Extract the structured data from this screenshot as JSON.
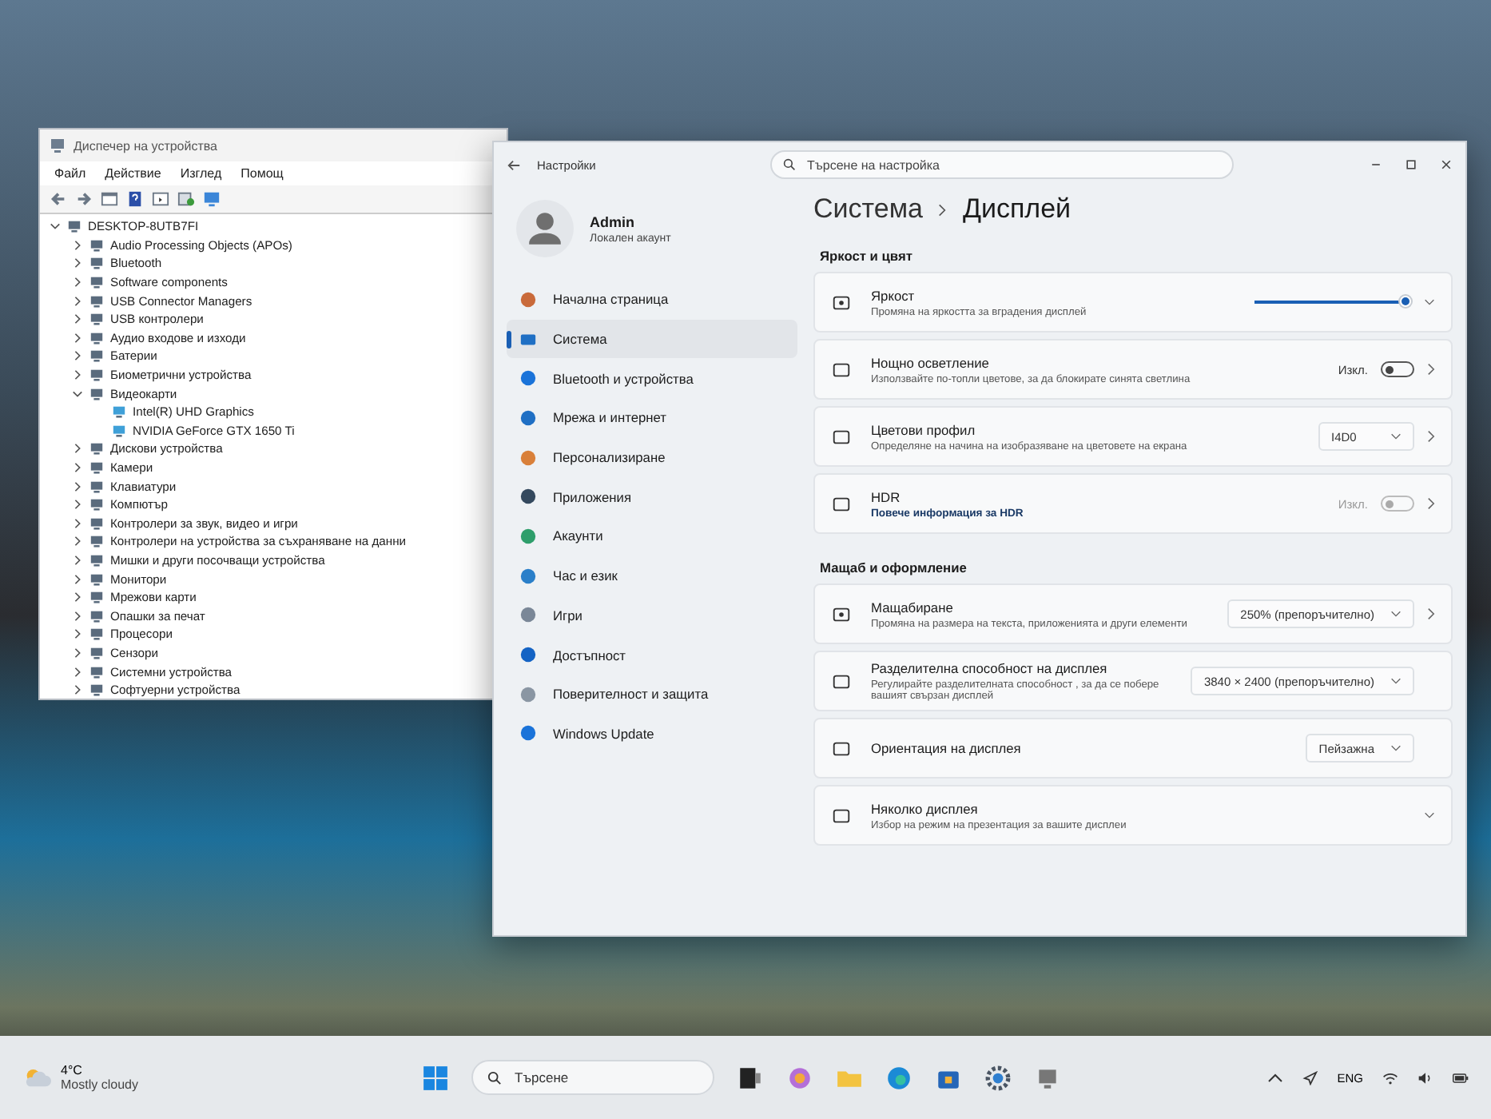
{
  "device_manager": {
    "title": "Диспечер на устройства",
    "menu": [
      "Файл",
      "Действие",
      "Изглед",
      "Помощ"
    ],
    "tree": [
      {
        "label": "DESKTOP-8UTB7FI",
        "expanded": true,
        "children": [
          {
            "label": "Audio Processing Objects (APOs)",
            "expanded": false
          },
          {
            "label": "Bluetooth",
            "expanded": false
          },
          {
            "label": "Software components",
            "expanded": false
          },
          {
            "label": "USB Connector Managers",
            "expanded": false
          },
          {
            "label": "USB контролери",
            "expanded": false
          },
          {
            "label": "Аудио входове и изходи",
            "expanded": false
          },
          {
            "label": "Батерии",
            "expanded": false
          },
          {
            "label": "Биометрични устройства",
            "expanded": false
          },
          {
            "label": "Видеокарти",
            "expanded": true,
            "children": [
              {
                "label": "Intel(R) UHD Graphics"
              },
              {
                "label": "NVIDIA GeForce GTX 1650 Ti"
              }
            ]
          },
          {
            "label": "Дискови устройства",
            "expanded": false
          },
          {
            "label": "Камери",
            "expanded": false
          },
          {
            "label": "Клавиатури",
            "expanded": false
          },
          {
            "label": "Компютър",
            "expanded": false
          },
          {
            "label": "Контролери за звук, видео и игри",
            "expanded": false
          },
          {
            "label": "Контролери на устройства за съхраняване на данни",
            "expanded": false
          },
          {
            "label": "Мишки и други посочващи устройства",
            "expanded": false
          },
          {
            "label": "Монитори",
            "expanded": false
          },
          {
            "label": "Мрежови карти",
            "expanded": false
          },
          {
            "label": "Опашки за печат",
            "expanded": false
          },
          {
            "label": "Процесори",
            "expanded": false
          },
          {
            "label": "Сензори",
            "expanded": false
          },
          {
            "label": "Системни устройства",
            "expanded": false
          },
          {
            "label": "Софтуерни устройства",
            "expanded": false
          }
        ]
      }
    ]
  },
  "settings": {
    "title": "Настройки",
    "search": {
      "placeholder": "Търсене на настройка"
    },
    "user": {
      "name": "Admin",
      "account": "Локален акаунт"
    },
    "nav": [
      {
        "label": "Начална страница",
        "selected": false
      },
      {
        "label": "Система",
        "selected": true
      },
      {
        "label": "Bluetooth и устройства",
        "selected": false
      },
      {
        "label": "Мрежа и интернет",
        "selected": false
      },
      {
        "label": "Персонализиране",
        "selected": false
      },
      {
        "label": "Приложения",
        "selected": false
      },
      {
        "label": "Акаунти",
        "selected": false
      },
      {
        "label": "Час и език",
        "selected": false
      },
      {
        "label": "Игри",
        "selected": false
      },
      {
        "label": "Достъпност",
        "selected": false
      },
      {
        "label": "Поверителност и защита",
        "selected": false
      },
      {
        "label": "Windows Update",
        "selected": false
      }
    ],
    "breadcrumb": [
      "Система",
      "Дисплей"
    ],
    "sections": [
      {
        "heading": "Яркост и цвят",
        "cards": [
          {
            "kind": "slider",
            "title": "Яркост",
            "subtitle": "Промяна на яркостта за вградения дисплей",
            "level": 1,
            "navigates": false,
            "expands": true
          },
          {
            "kind": "toggle",
            "title": "Нощно осветление",
            "subtitle": "Използвайте по-топли цветове, за да блокирате синята светлина",
            "state": "Изкл.",
            "on": false,
            "disabled": false,
            "navigates": true,
            "expands": false
          },
          {
            "kind": "dropdown",
            "title": "Цветови профил",
            "subtitle": "Определяне на начина на изобразяване на цветовете на екрана",
            "value": "I4D0",
            "navigates": true,
            "expands": false
          },
          {
            "kind": "toggle",
            "title": "HDR",
            "link": "Повече информация за HDR",
            "state": "Изкл.",
            "on": false,
            "disabled": true,
            "navigates": true,
            "expands": false
          }
        ]
      },
      {
        "heading": "Мащаб и оформление",
        "cards": [
          {
            "kind": "dropdown",
            "title": "Мащабиране",
            "subtitle": "Промяна на размера на текста, приложенията и други елементи",
            "value": "250% (препоръчително)",
            "navigates": true,
            "expands": false
          },
          {
            "kind": "dropdown",
            "title": "Разделителна способност на дисплея",
            "subtitle": "Регулирайте разделителната способност , за да се побере вашият свързан дисплей",
            "value": "3840 × 2400 (препоръчително)",
            "navigates": false,
            "expands": false
          },
          {
            "kind": "dropdown",
            "title": "Ориентация на дисплея",
            "value": "Пейзажна",
            "navigates": false,
            "expands": false
          },
          {
            "kind": "expander",
            "title": "Няколко дисплея",
            "subtitle": "Избор на режим на презентация за вашите дисплеи",
            "navigates": false,
            "expands": true
          }
        ]
      }
    ]
  },
  "taskbar": {
    "weather": {
      "temperature": "4°C",
      "condition": "Mostly cloudy"
    },
    "search": {
      "placeholder": "Търсене"
    },
    "language": "ENG"
  }
}
